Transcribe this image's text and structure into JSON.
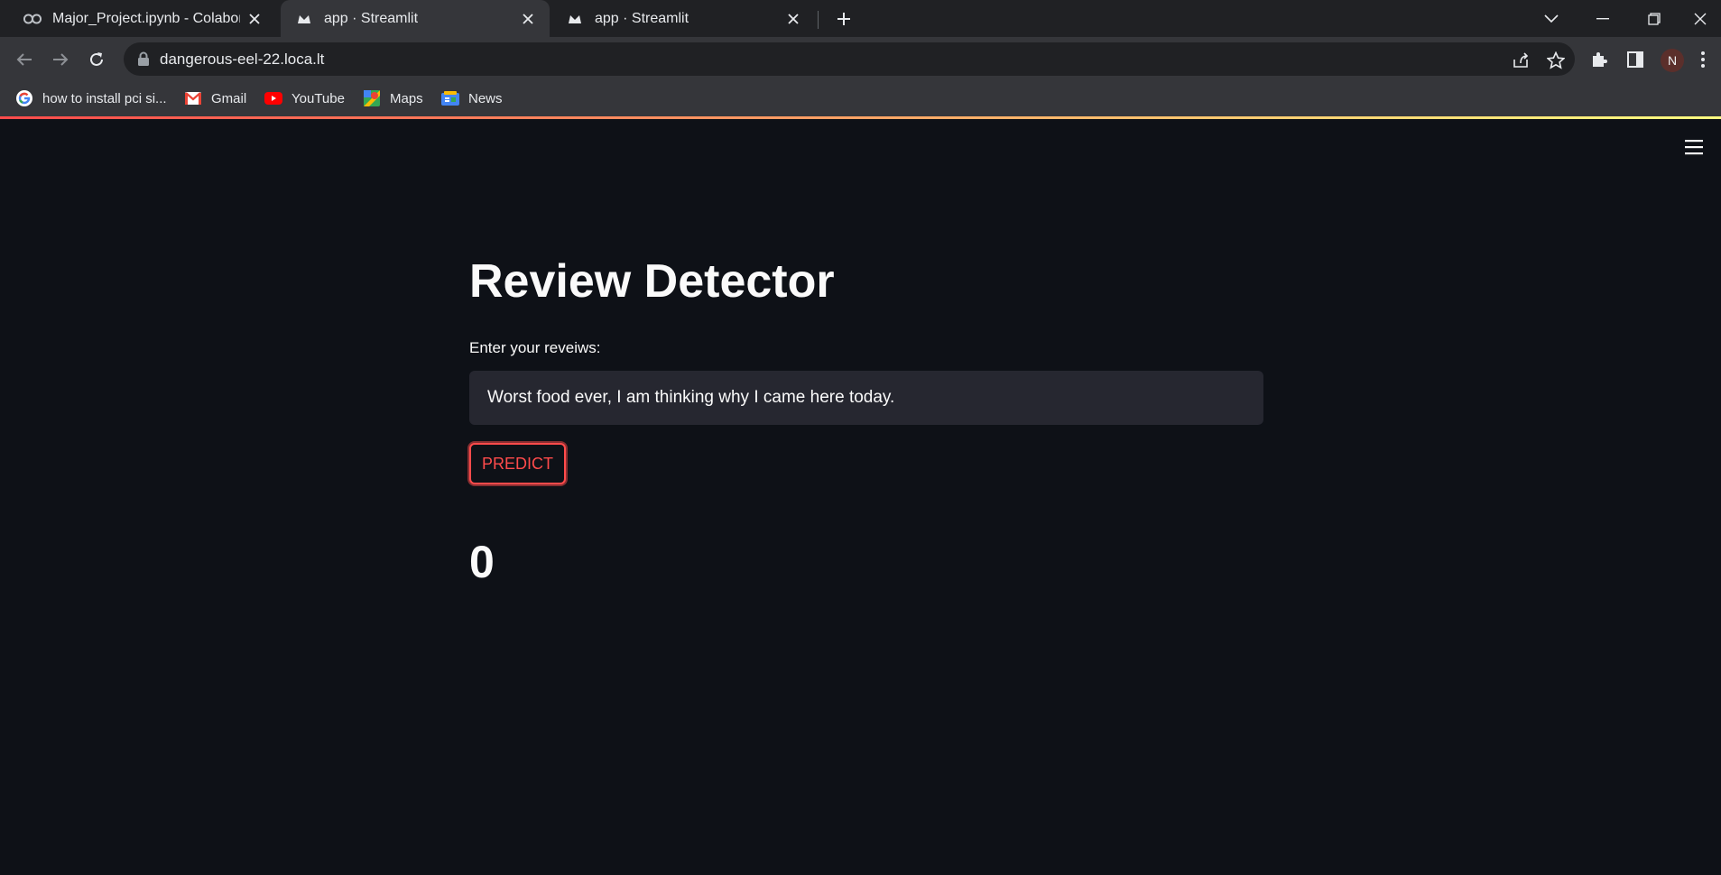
{
  "browser": {
    "tabs": [
      {
        "title": "Major_Project.ipynb - Colaboratory",
        "icon": "colab-icon",
        "active": false
      },
      {
        "title": "app · Streamlit",
        "icon": "streamlit-icon",
        "active": true
      },
      {
        "title": "app · Streamlit",
        "icon": "streamlit-icon",
        "active": false
      }
    ],
    "address": "dangerous-eel-22.loca.lt",
    "profile_initial": "N",
    "bookmarks": [
      {
        "label": "how to install pci si...",
        "icon": "google-icon"
      },
      {
        "label": "Gmail",
        "icon": "gmail-icon"
      },
      {
        "label": "YouTube",
        "icon": "youtube-icon"
      },
      {
        "label": "Maps",
        "icon": "maps-icon"
      },
      {
        "label": "News",
        "icon": "news-icon"
      }
    ]
  },
  "app": {
    "title": "Review Detector",
    "input_label": "Enter your reveiws:",
    "input_value": "Worst food ever, I am thinking why I came here today.",
    "predict_label": "PREDICT",
    "result": "0"
  },
  "colors": {
    "background": "#0e1117",
    "input_bg": "#262730",
    "accent": "#ff4b4b",
    "text": "#fafafa"
  }
}
